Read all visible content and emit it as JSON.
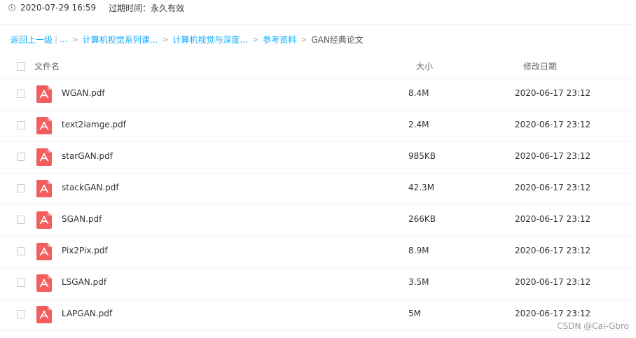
{
  "share_info": {
    "created": "2020-07-29 16:59",
    "expire_label": "过期时间：",
    "expire_value": "永久有效"
  },
  "breadcrumb": {
    "back": "返回上一级",
    "pipe": "|",
    "ellipsis": "...",
    "items": [
      "计算机视觉系列课...",
      "计算机视觉与深度...",
      "参考资料"
    ],
    "current": "GAN经典论文",
    "separator": ">"
  },
  "table": {
    "headers": {
      "name": "文件名",
      "size": "大小",
      "date": "修改日期"
    },
    "rows": [
      {
        "name": "WGAN.pdf",
        "size": "8.4M",
        "date": "2020-06-17 23:12"
      },
      {
        "name": "text2iamge.pdf",
        "size": "2.4M",
        "date": "2020-06-17 23:12"
      },
      {
        "name": "starGAN.pdf",
        "size": "985KB",
        "date": "2020-06-17 23:12"
      },
      {
        "name": "stackGAN.pdf",
        "size": "42.3M",
        "date": "2020-06-17 23:12"
      },
      {
        "name": "SGAN.pdf",
        "size": "266KB",
        "date": "2020-06-17 23:12"
      },
      {
        "name": "Pix2Pix.pdf",
        "size": "8.9M",
        "date": "2020-06-17 23:12"
      },
      {
        "name": "LSGAN.pdf",
        "size": "3.5M",
        "date": "2020-06-17 23:12"
      },
      {
        "name": "LAPGAN.pdf",
        "size": "5M",
        "date": "2020-06-17 23:12"
      }
    ]
  },
  "watermark": "CSDN @Cai-Gbro",
  "colors": {
    "link": "#09aaff",
    "pdf_icon": "#f25e5e"
  },
  "icons": {
    "clock": "clock-icon",
    "file": "pdf-file-icon"
  }
}
